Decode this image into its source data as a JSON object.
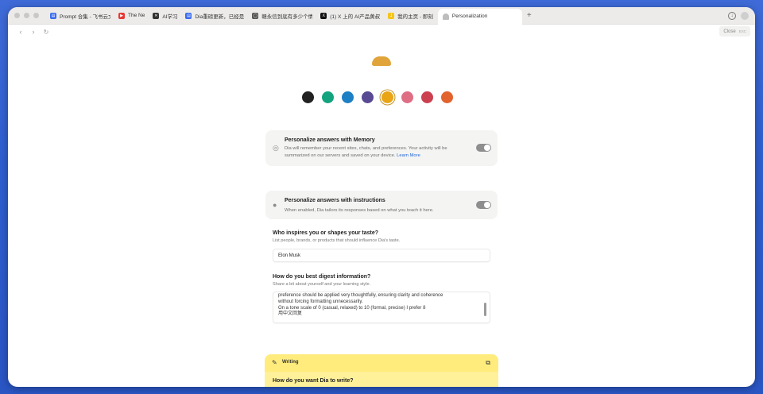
{
  "tabs": [
    {
      "label": "Prompt 合集 - 飞书云文",
      "fav_color": "#3b6cf0",
      "fav_glyph": "▤"
    },
    {
      "label": "The Ne",
      "fav_color": "#e53935",
      "fav_glyph": "▶"
    },
    {
      "label": "AI学习",
      "fav_color": "#333333",
      "fav_glyph": "✕"
    },
    {
      "label": "Dia重磅更新，已经是",
      "fav_color": "#3b6cf0",
      "fav_glyph": "▤"
    },
    {
      "label": "赣永信到底有多少个情",
      "fav_color": "#555555",
      "fav_glyph": "◯"
    },
    {
      "label": "(1) X 上的 AI产品黄叔",
      "fav_color": "#111111",
      "fav_glyph": "X"
    },
    {
      "label": "我的主页 - 即刻",
      "fav_color": "#f5c518",
      "fav_glyph": "J"
    }
  ],
  "active_tab": {
    "label": "Personalization"
  },
  "toolbar": {
    "close_label": "Close",
    "close_key": "ESC"
  },
  "swatches": [
    {
      "color": "#222222",
      "selected": false
    },
    {
      "color": "#14a37f",
      "selected": false
    },
    {
      "color": "#1d7fc4",
      "selected": false
    },
    {
      "color": "#584a93",
      "selected": false
    },
    {
      "color": "#e9a516",
      "selected": true
    },
    {
      "color": "#df6e84",
      "selected": false
    },
    {
      "color": "#cc4150",
      "selected": false
    },
    {
      "color": "#e2632d",
      "selected": false
    }
  ],
  "memory": {
    "title": "Personalize answers with Memory",
    "desc": "Dia will remember your recent sites, chats, and preferences. Your activity will be summarized on our servers and saved on your device.",
    "link": "Learn More",
    "enabled": true
  },
  "instructions": {
    "title": "Personalize answers with instructions",
    "desc": "When enabled, Dia tailors its responses based on what you teach it here.",
    "enabled": true
  },
  "taste": {
    "question": "Who inspires you or shapes your taste?",
    "hint": "List people, brands, or products that should influence Dia's taste.",
    "value": "Elon Musk"
  },
  "digest": {
    "question": "How do you best digest information?",
    "hint": "Share a bit about yourself and your learning style.",
    "lines": [
      "preference should be applied very thoughtfully, ensuring clarity and coherence",
      "without forcing formatting unnecessarily.",
      "On a tone scale of 0 (casual, relaxed) to 10 (formal, precise) I prefer 8",
      "用中文回复"
    ]
  },
  "writing": {
    "label": "Writing",
    "question": "How do you want Dia to write?"
  }
}
